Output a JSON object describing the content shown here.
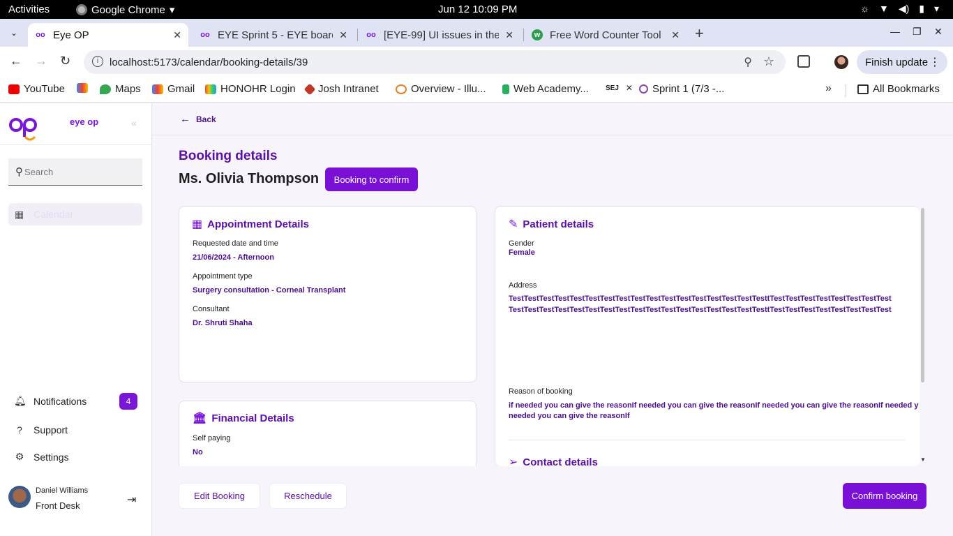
{
  "os": {
    "activities": "Activities",
    "app_name": "Google Chrome",
    "clock": "Jun 12  10:09 PM"
  },
  "tabs": [
    {
      "title": "Eye OP",
      "active": true
    },
    {
      "title": "EYE Sprint 5 - EYE board",
      "active": false
    },
    {
      "title": "[EYE-99] UI issues in the",
      "active": false
    },
    {
      "title": "Free Word Counter Tool",
      "active": false
    }
  ],
  "toolbar": {
    "url": "localhost:5173/calendar/booking-details/39",
    "finish_update": "Finish update"
  },
  "bookmarks": [
    "YouTube",
    "Maps",
    "Gmail",
    "HONOHR Login",
    "Josh Intranet",
    "Overview - Illu...",
    "Web Academy...",
    "Sprint 1 (7/3 -...",
    "All Bookmarks"
  ],
  "sidebar": {
    "logo_text": "eye op",
    "search_placeholder": "Search",
    "calendar_label": "Calendar",
    "notifications_label": "Notifications",
    "notifications_count": "4",
    "support_label": "Support",
    "settings_label": "Settings",
    "user_name": "Daniel Williams",
    "user_role": "Front Desk"
  },
  "main": {
    "back_label": "Back",
    "page_title": "Booking details",
    "patient_name": "Ms. Olivia Thompson",
    "status_button": "Booking to confirm",
    "appointment": {
      "heading": "Appointment Details",
      "requested_label": "Requested date and time",
      "requested_value": "21/06/2024 - Afternoon",
      "type_label": "Appointment type",
      "type_value": "Surgery consultation - Corneal Transplant",
      "consultant_label": "Consultant",
      "consultant_value": "Dr. Shruti Shaha"
    },
    "financial": {
      "heading": "Financial Details",
      "self_paying_label": "Self paying",
      "self_paying_value": "No"
    },
    "patient": {
      "heading": "Patient details",
      "gender_label": "Gender",
      "gender_value": "Female",
      "address_label": "Address",
      "address_line1": "TestTestTestTestTestTestTestTestTestTestTestTestTestTestTestTestTesttTestTestTestTestTestTestTestTest",
      "address_line2": "TestTestTestTestTestTestTestTestTestTestTestTestTestTestTestTestTesttTestTestTestTestTestTestTestTest",
      "reason_label": "Reason of booking",
      "reason_line1": "if needed you can give the reasonIf needed you can give the reasonIf needed you can give the reasonIf needed y",
      "reason_line2": "needed you can give the reasonIf"
    },
    "contact": {
      "heading": "Contact details"
    },
    "buttons": {
      "edit": "Edit Booking",
      "reschedule": "Reschedule",
      "confirm": "Confirm booking"
    }
  }
}
